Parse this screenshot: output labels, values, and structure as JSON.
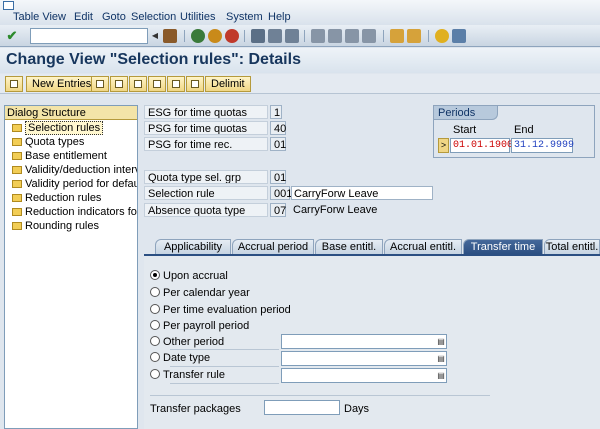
{
  "menu": {
    "items": [
      "Table View",
      "Edit",
      "Goto",
      "Selection",
      "Utilities",
      "System",
      "Help"
    ]
  },
  "title": "Change View \"Selection rules\": Details",
  "toolbar": {
    "new_entries": "New Entries",
    "delimit": "Delimit"
  },
  "tree": {
    "title": "Dialog Structure",
    "items": [
      "Selection rules",
      "Quota types",
      "Base entitlement",
      "Validity/deduction interv",
      "Validity period for defau",
      "Reduction rules",
      "Reduction indicators fo",
      "Rounding rules"
    ]
  },
  "fields": {
    "esg_label": "ESG for time quotas",
    "esg_value": "1",
    "psg_quotas_label": "PSG for time quotas",
    "psg_quotas_value": "40",
    "psg_rec_label": "PSG for time rec.",
    "psg_rec_value": "01",
    "quota_grp_label": "Quota type sel. grp",
    "quota_grp_value": "01",
    "sel_rule_label": "Selection rule",
    "sel_rule_value": "001",
    "sel_rule_text": "CarryForw Leave",
    "absence_label": "Absence quota type",
    "absence_value": "07",
    "absence_text": "CarryForw Leave"
  },
  "periods": {
    "title": "Periods",
    "start_label": "Start",
    "end_label": "End",
    "start_value": "01.01.1900",
    "end_value": "31.12.9999",
    "marker": ">"
  },
  "tabs": [
    "Applicability",
    "Accrual period",
    "Base entitl.",
    "Accrual entitl.",
    "Transfer time",
    "Total entitl."
  ],
  "transfer": {
    "options": [
      "Upon accrual",
      "Per calendar year",
      "Per time evaluation period",
      "Per payroll period",
      "Other period",
      "Date type",
      "Transfer rule"
    ],
    "selected": 0,
    "packages_label": "Transfer packages",
    "packages_unit": "Days"
  },
  "colors": {
    "accent": "#2b4f82",
    "start_date": "#cc0000",
    "end_date": "#1f3fbf"
  }
}
